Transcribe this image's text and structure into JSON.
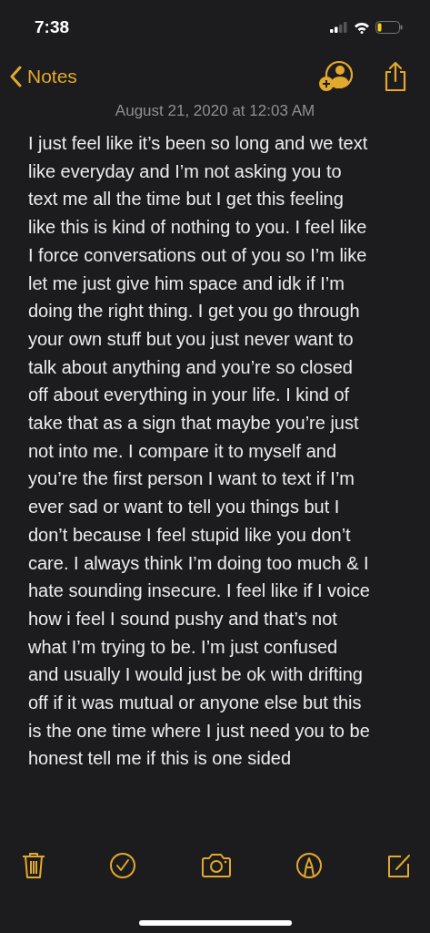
{
  "status_bar": {
    "time": "7:38"
  },
  "nav": {
    "back_label": "Notes"
  },
  "note": {
    "date": "August 21, 2020 at 12:03 AM",
    "lines": [
      "I just feel like it’s been so long and we text",
      "like everyday and I’m not asking you to",
      "text me all the time but I get this feeling",
      "like this is kind of nothing to you. I feel like",
      "I force conversations out of you so I’m like",
      "let me just give him space and idk if I’m",
      "doing the right thing. I get you go through",
      "your own stuff but you just never want to",
      "talk about anything and you’re so closed",
      "off about everything in your life. I kind of",
      "take that as a sign that maybe you’re just",
      "not into me. I compare it to myself and",
      "you’re the first person I want to text if I’m",
      "ever sad or want to tell you things but I",
      "don’t because I feel stupid like you don’t",
      "care. I always think I’m doing too much & I",
      "hate sounding insecure. I feel like if I voice",
      "how i feel I sound pushy and that’s not",
      "what I’m trying to be. I’m just confused",
      "and usually I would just be ok with drifting",
      "off if it was mutual or anyone else but this",
      "is the one time where I just need you to be",
      "honest tell me if this is one sided"
    ]
  },
  "toolbar": [
    {
      "kind": "trash"
    },
    {
      "kind": "check"
    },
    {
      "kind": "camera"
    },
    {
      "kind": "markup"
    },
    {
      "kind": "compose"
    }
  ]
}
